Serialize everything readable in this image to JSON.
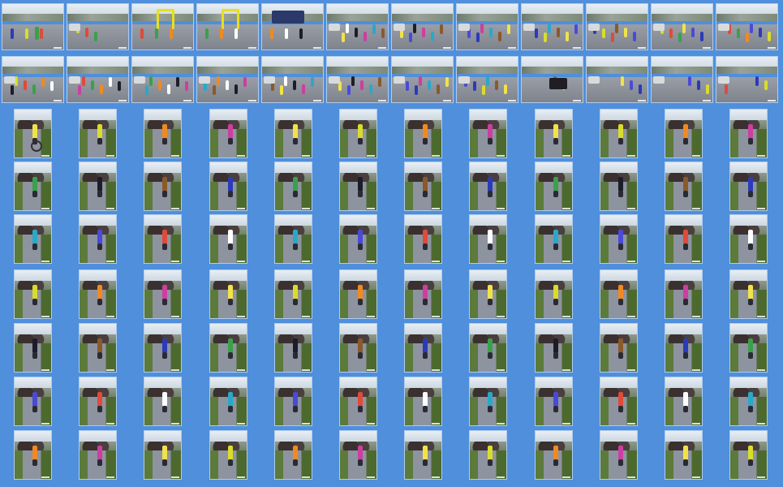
{
  "page": {
    "background": "#4f8fdc"
  },
  "gallery": {
    "rows": [
      {
        "kind": "landscape",
        "photos": [
          "flag",
          "road",
          "gate",
          "gate",
          "tent",
          "runners",
          "runners",
          "runners",
          "runners",
          "runners",
          "runners",
          "runners"
        ]
      },
      {
        "kind": "landscape",
        "photos": [
          "runners",
          "runners",
          "runners",
          "runners",
          "runners",
          "runners",
          "runners",
          "runners",
          "car",
          "banner",
          "road",
          "road"
        ]
      },
      {
        "kind": "portrait",
        "photos": [
          "bike",
          "runner",
          "runner",
          "runner",
          "runner",
          "runner",
          "runner",
          "runner",
          "runner",
          "runner",
          "runner",
          "runner"
        ]
      },
      {
        "kind": "portrait",
        "photos": [
          "runner",
          "runner",
          "runner",
          "runner",
          "runner",
          "runner",
          "runner",
          "runner",
          "runner",
          "runner",
          "runner",
          "runner"
        ]
      },
      {
        "kind": "portrait",
        "photos": [
          "runner",
          "runner",
          "runner",
          "runner",
          "runner",
          "runner",
          "runner",
          "runner",
          "runner",
          "runner",
          "runner",
          "runner"
        ]
      },
      {
        "kind": "portrait",
        "photos": [
          "runner",
          "runner",
          "runner",
          "runner",
          "runner",
          "runner",
          "runner",
          "runner",
          "runner",
          "runner",
          "runner",
          "runner"
        ]
      },
      {
        "kind": "portrait",
        "photos": [
          "runner",
          "runner",
          "runner",
          "runner",
          "runner",
          "runner",
          "runner",
          "runner",
          "runner",
          "runner",
          "runner",
          "runner"
        ]
      },
      {
        "kind": "portrait",
        "photos": [
          "runner",
          "runner",
          "runner",
          "runner",
          "runner",
          "runner",
          "runner",
          "runner",
          "runner",
          "runner",
          "runner",
          "runner"
        ]
      },
      {
        "kind": "portrait",
        "photos": [
          "runner",
          "runner",
          "runner",
          "runner",
          "runner",
          "runner",
          "runner",
          "runner",
          "runner",
          "runner",
          "runner",
          "runner"
        ]
      }
    ],
    "runner_colors": [
      "#2b3bb8",
      "#d9dd2a",
      "#e04a3a",
      "#3aa14a",
      "#f08a20",
      "#ffffff",
      "#1d1d2a",
      "#cc3fa0",
      "#2aa8c8",
      "#8a5a2a",
      "#f2e24a",
      "#4a4ad8"
    ]
  }
}
